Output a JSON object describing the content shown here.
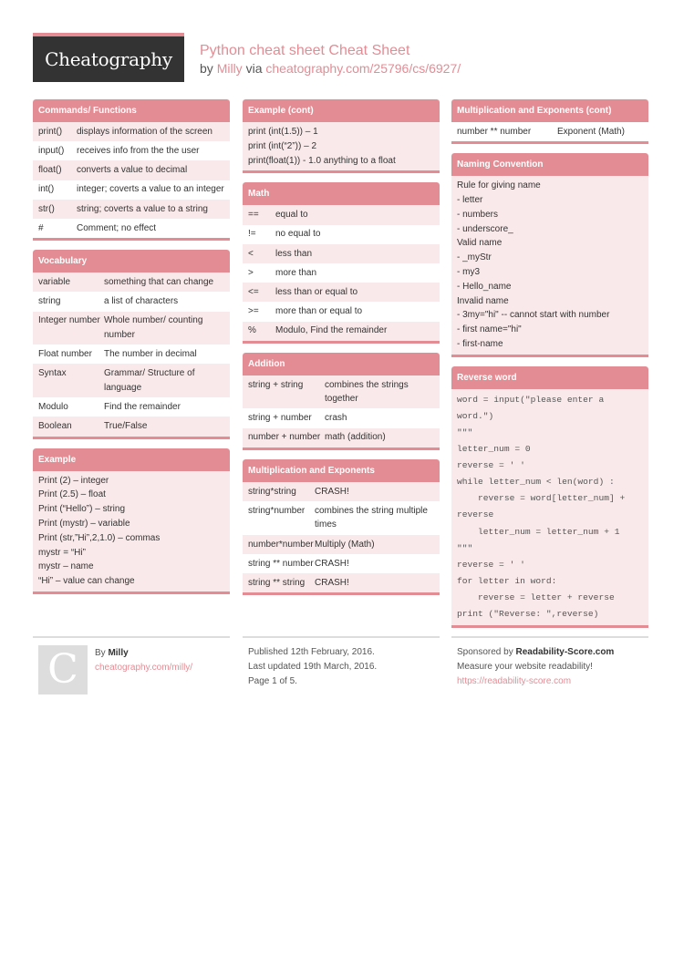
{
  "header": {
    "logo": "Cheatography",
    "title": "Python cheat sheet Cheat Sheet",
    "by_label": "by",
    "author": "Milly",
    "via_label": "via",
    "url": "cheatography.com/25796/cs/6927/"
  },
  "colors": {
    "accent": "#e48c94",
    "row_tint": "#fae9ea",
    "logo_bg": "#333333"
  },
  "commands": {
    "title": "Commands/ Functions",
    "rows": [
      {
        "k": "print()",
        "v": "displays information of the screen"
      },
      {
        "k": "input()",
        "v": "receives info from the the user"
      },
      {
        "k": "float()",
        "v": "converts a value to decimal"
      },
      {
        "k": "int()",
        "v": "integer; coverts a value to an integer"
      },
      {
        "k": "str()",
        "v": "string; coverts a value to a string"
      },
      {
        "k": "#",
        "v": "Comment; no effect"
      }
    ]
  },
  "vocabulary": {
    "title": "Vocabulary",
    "rows": [
      {
        "k": "variable",
        "v": "something that can change"
      },
      {
        "k": "string",
        "v": "a list of characters"
      },
      {
        "k": "Integer number",
        "v": "Whole number/ counting number"
      },
      {
        "k": "Float number",
        "v": "The number in decimal"
      },
      {
        "k": "Syntax",
        "v": "Grammar/ Structure of language"
      },
      {
        "k": "Modulo",
        "v": "Find the remainder"
      },
      {
        "k": "Boolean",
        "v": "True/False"
      }
    ]
  },
  "example": {
    "title": "Example",
    "lines": [
      "Print (2) – integer",
      "Print (2.5) – float",
      "Print (“Hello”) – string",
      "Print (mystr) – variable",
      "Print (str,”Hi”,2,1.0) – commas",
      "mystr = “Hi”",
      "mystr – name",
      "“Hi” – value can change"
    ]
  },
  "example_cont": {
    "title": "Example (cont)",
    "lines": [
      "print (int(1.5)) – 1",
      "print (int(“2”)) – 2",
      "print(float(1)) - 1.0 anything to a float"
    ]
  },
  "math": {
    "title": "Math",
    "rows": [
      {
        "k": "==",
        "v": "equal to"
      },
      {
        "k": "!=",
        "v": "no equal to"
      },
      {
        "k": "<",
        "v": "less than"
      },
      {
        "k": ">",
        "v": "more than"
      },
      {
        "k": "<=",
        "v": "less than or equal to"
      },
      {
        "k": ">=",
        "v": "more than or equal to"
      },
      {
        "k": "%",
        "v": "Modulo, Find the remainder"
      }
    ]
  },
  "addition": {
    "title": "Addition",
    "rows": [
      {
        "k": "string + string",
        "v": "combines the strings together"
      },
      {
        "k": "string + number",
        "v": "crash"
      },
      {
        "k": "number + number",
        "v": "math (addition)"
      }
    ]
  },
  "multiplication": {
    "title": "Multiplication and Exponents",
    "rows": [
      {
        "k": "string*string",
        "v": "CRASH!"
      },
      {
        "k": "string*number",
        "v": "combines the string multiple times"
      },
      {
        "k": "number*number",
        "v": "Multiply (Math)"
      },
      {
        "k": "string ** number",
        "v": "CRASH!"
      },
      {
        "k": "string ** string",
        "v": "CRASH!"
      }
    ]
  },
  "multiplication_cont": {
    "title": "Multiplication and Exponents (cont)",
    "rows": [
      {
        "k": "number ** number",
        "v": "Exponent (Math)"
      }
    ]
  },
  "naming": {
    "title": "Naming Convention",
    "lines": [
      "Rule for giving name",
      "- letter",
      "- numbers",
      "- underscore_",
      "Valid name",
      "- _myStr",
      "- my3",
      "- Hello_name",
      "Invalid name",
      "- 3my=\"hi\" -- cannot start with number",
      "- first name=\"hi\"",
      "- first-name"
    ]
  },
  "reverse": {
    "title": "Reverse word",
    "lines": [
      "word = input(\"please enter a",
      "word.\")",
      "\"\"\"",
      "letter_num = 0",
      "reverse = ' '",
      "while letter_num < len(word) :",
      "    reverse = word[letter_num] +",
      "reverse",
      "    letter_num = letter_num + 1",
      "\"\"\"",
      "reverse = ' '",
      "for letter in word:",
      "    reverse = letter + reverse",
      "print (\"Reverse: \",reverse)"
    ]
  },
  "footer": {
    "avatar_letter": "C",
    "by_label": "By",
    "author": "Milly",
    "author_url": "cheatography.com/milly/",
    "published": "Published 12th February, 2016.",
    "updated": "Last updated 19th March, 2016.",
    "page": "Page 1 of 5.",
    "sponsored_label": "Sponsored by",
    "sponsor": "Readability-Score.com",
    "sponsor_tagline": "Measure your website readability!",
    "sponsor_url": "https://readability-score.com"
  }
}
